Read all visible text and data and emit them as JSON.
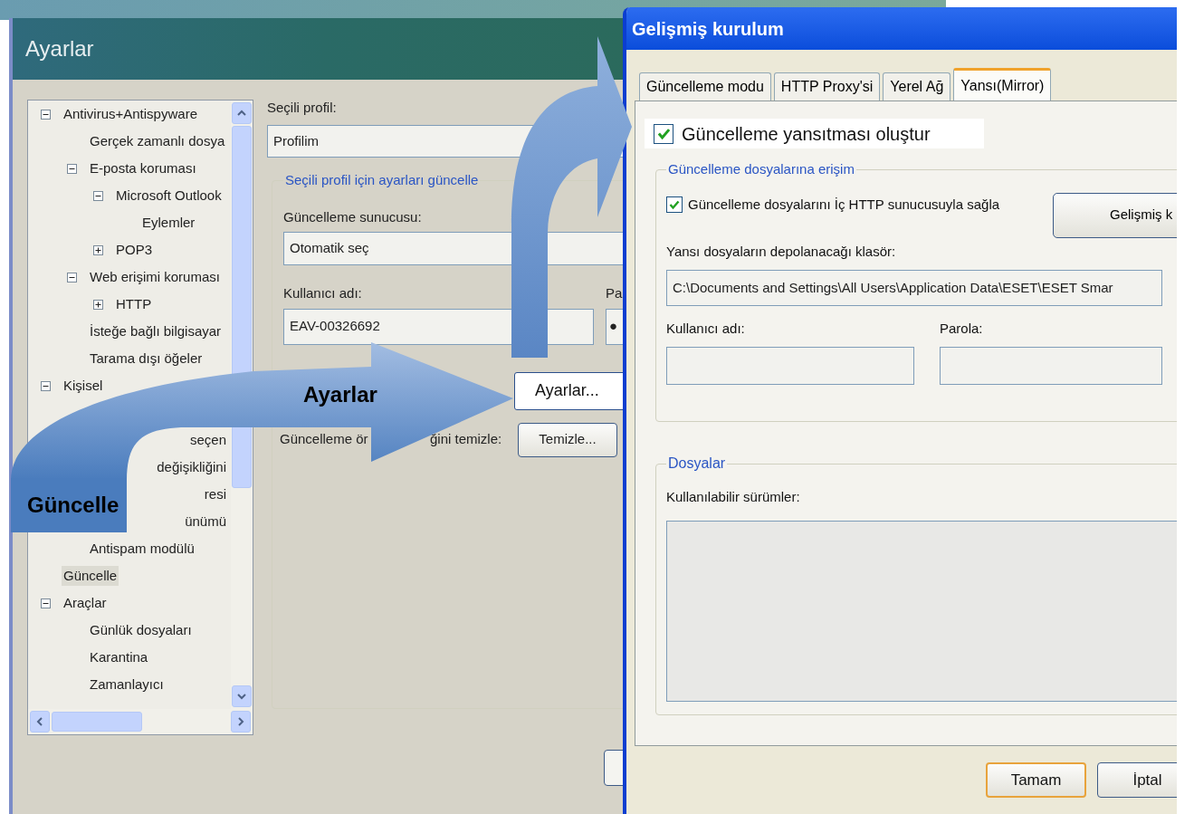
{
  "settings_window": {
    "title": "Ayarlar",
    "tree": [
      {
        "kind": "item",
        "label": "Antivirus+Antispyware",
        "selected": false,
        "expanded": true,
        "children": [
          {
            "kind": "item",
            "label": "Gerçek zamanlı dosya",
            "selected": false
          },
          {
            "kind": "item",
            "label": "E-posta koruması",
            "selected": false,
            "expanded": true,
            "children": [
              {
                "kind": "item",
                "label": "Microsoft Outlook",
                "selected": false,
                "expanded": true,
                "children": [
                  {
                    "kind": "item",
                    "label": "Eylemler",
                    "selected": false
                  }
                ]
              },
              {
                "kind": "item",
                "label": "POP3",
                "selected": false,
                "expanded": false
              }
            ]
          },
          {
            "kind": "item",
            "label": "Web erişimi koruması",
            "selected": false,
            "expanded": true,
            "children": [
              {
                "kind": "item",
                "label": "HTTP",
                "selected": false,
                "expanded": false
              }
            ]
          },
          {
            "kind": "item",
            "label": "İsteğe bağlı bilgisayar",
            "selected": false
          },
          {
            "kind": "item",
            "label": "Tarama dışı öğeler",
            "selected": false
          }
        ]
      },
      {
        "kind": "item",
        "label": "Kişisel",
        "selected": false,
        "expanded": true,
        "children": [
          {
            "kind": "covered"
          },
          {
            "kind": "cut",
            "label": "seçen",
            "selected": false
          },
          {
            "kind": "cut",
            "label": "değişikliğini",
            "selected": false
          },
          {
            "kind": "cut",
            "label": "resi",
            "selected": false
          },
          {
            "kind": "cut",
            "label": "ünümü",
            "selected": false
          },
          {
            "kind": "item",
            "label": "Antispam modülü",
            "selected": false
          }
        ]
      },
      {
        "kind": "item",
        "label": "Güncelle",
        "selected": true
      },
      {
        "kind": "item",
        "label": "Araçlar",
        "selected": false,
        "expanded": true,
        "children": [
          {
            "kind": "item",
            "label": "Günlük dosyaları",
            "selected": false
          },
          {
            "kind": "item",
            "label": "Karantina",
            "selected": false
          },
          {
            "kind": "item",
            "label": "Zamanlayıcı",
            "selected": false
          }
        ]
      }
    ],
    "profile_label": "Seçili profil:",
    "profile_value": "Profilim",
    "group_title": "Seçili profil için ayarları güncelle",
    "server_label": "Güncelleme sunucusu:",
    "server_value": "Otomatik seç",
    "username_label": "Kullanıcı adı:",
    "username_value": "EAV-00326692",
    "password_label": "Pa",
    "password_value": "●",
    "settings_button": "Ayarlar...",
    "cache_label_parts": [
      "Güncelleme ör",
      "ğini temizle:"
    ],
    "clear_button": "Temizle..."
  },
  "advanced_dialog": {
    "title": "Gelişmiş kurulum",
    "tabs": [
      {
        "label": "Güncelleme modu",
        "selected": false
      },
      {
        "label": "HTTP Proxy'si",
        "selected": false
      },
      {
        "label": "Yerel Ağ",
        "selected": false
      },
      {
        "label": "Yansı(Mirror)",
        "selected": true
      }
    ],
    "mirror_checkbox": {
      "label": "Güncelleme yansıtması oluştur",
      "checked": true
    },
    "access_group": {
      "title": "Güncelleme dosyalarına erişim",
      "http_checkbox": {
        "label": "Güncelleme dosyalarını İç HTTP sunucusuyla sağla",
        "checked": true
      },
      "advanced_button": "Gelişmiş k",
      "folder_label": "Yansı dosyaların depolanacağı klasör:",
      "folder_value": "C:\\Documents and Settings\\All Users\\Application Data\\ESET\\ESET Smar",
      "username_label": "Kullanıcı adı:",
      "password_label": "Parola:"
    },
    "files_group": {
      "title": "Dosyalar",
      "versions_label": "Kullanılabilir sürümler:"
    },
    "buttons": [
      {
        "label": "Tamam",
        "default": true
      },
      {
        "label": "İptal",
        "default": false
      }
    ]
  },
  "callouts": [
    {
      "kind": "bend-up"
    },
    {
      "kind": "bend-right",
      "label": "Ayarlar",
      "tail_label": "Güncelle"
    }
  ]
}
